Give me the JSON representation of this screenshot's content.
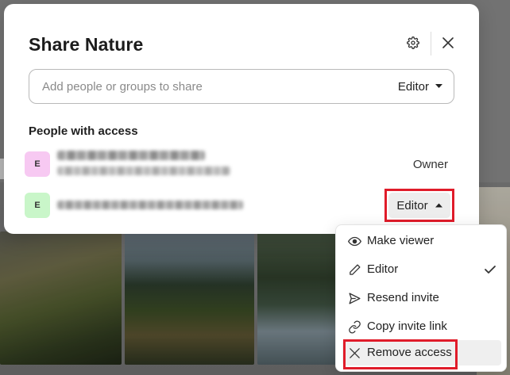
{
  "dialog": {
    "title": "Share Nature",
    "settings_icon": "gear-icon",
    "close_icon": "close-icon"
  },
  "share": {
    "placeholder": "Add people or groups to share",
    "role_label": "Editor",
    "role_icon": "caret-down-icon"
  },
  "access": {
    "heading": "People with access",
    "people": [
      {
        "initial": "E",
        "role": "Owner",
        "avatar_color": "#f7c9f2"
      },
      {
        "initial": "E",
        "role": "Editor",
        "avatar_color": "#c9f6c9"
      }
    ]
  },
  "role_menu": {
    "items": [
      {
        "label": "Make viewer",
        "icon": "eye-icon"
      },
      {
        "label": "Editor",
        "icon": "pencil-icon",
        "selected": true
      },
      {
        "label": "Resend invite",
        "icon": "send-icon"
      },
      {
        "label": "Copy invite link",
        "icon": "link-icon"
      },
      {
        "label": "Remove access",
        "icon": "x-icon"
      }
    ]
  },
  "colors": {
    "highlight": "#e01c2a",
    "editor_button_bg": "#ededed"
  }
}
